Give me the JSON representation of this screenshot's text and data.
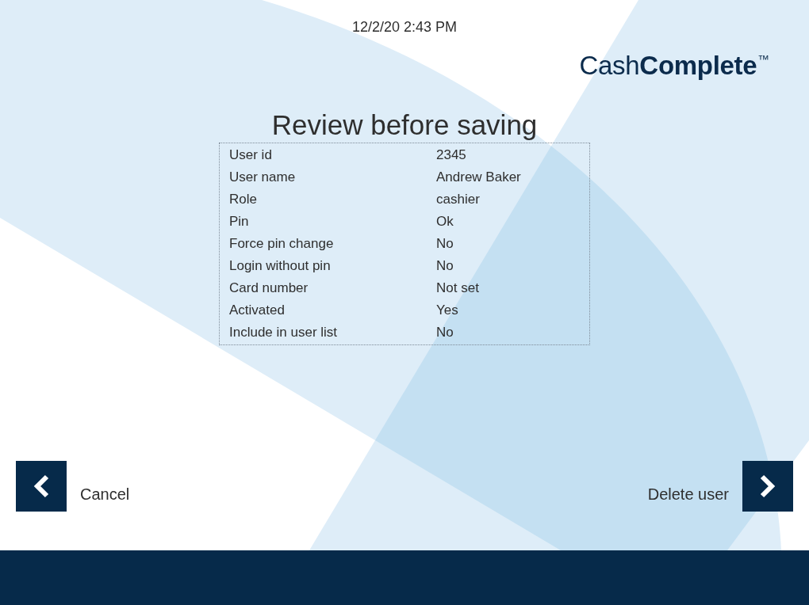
{
  "header": {
    "timestamp": "12/2/20 2:43 PM",
    "logo": "Cash**Complete**$^{™}$"
  },
  "title": "Review before saving",
  "summary": {
    "rows": [
      {
        "label": "User id",
        "value": "2345"
      },
      {
        "label": "User name",
        "value": "Andrew Baker"
      },
      {
        "label": "Role",
        "value": "cashier"
      },
      {
        "label": "Pin",
        "value": "Ok"
      },
      {
        "label": "Force pin change",
        "value": "No"
      },
      {
        "label": "Login without pin",
        "value": "No"
      },
      {
        "label": "Card number",
        "value": "Not set"
      },
      {
        "label": "Activated",
        "value": "Yes"
      },
      {
        "label": "Include in user list",
        "value": "No"
      }
    ]
  },
  "navigation": [
    {
      "kind": "back",
      "label": "Cancel"
    },
    {
      "kind": "forward",
      "label": "Delete user"
    }
  ]
}
